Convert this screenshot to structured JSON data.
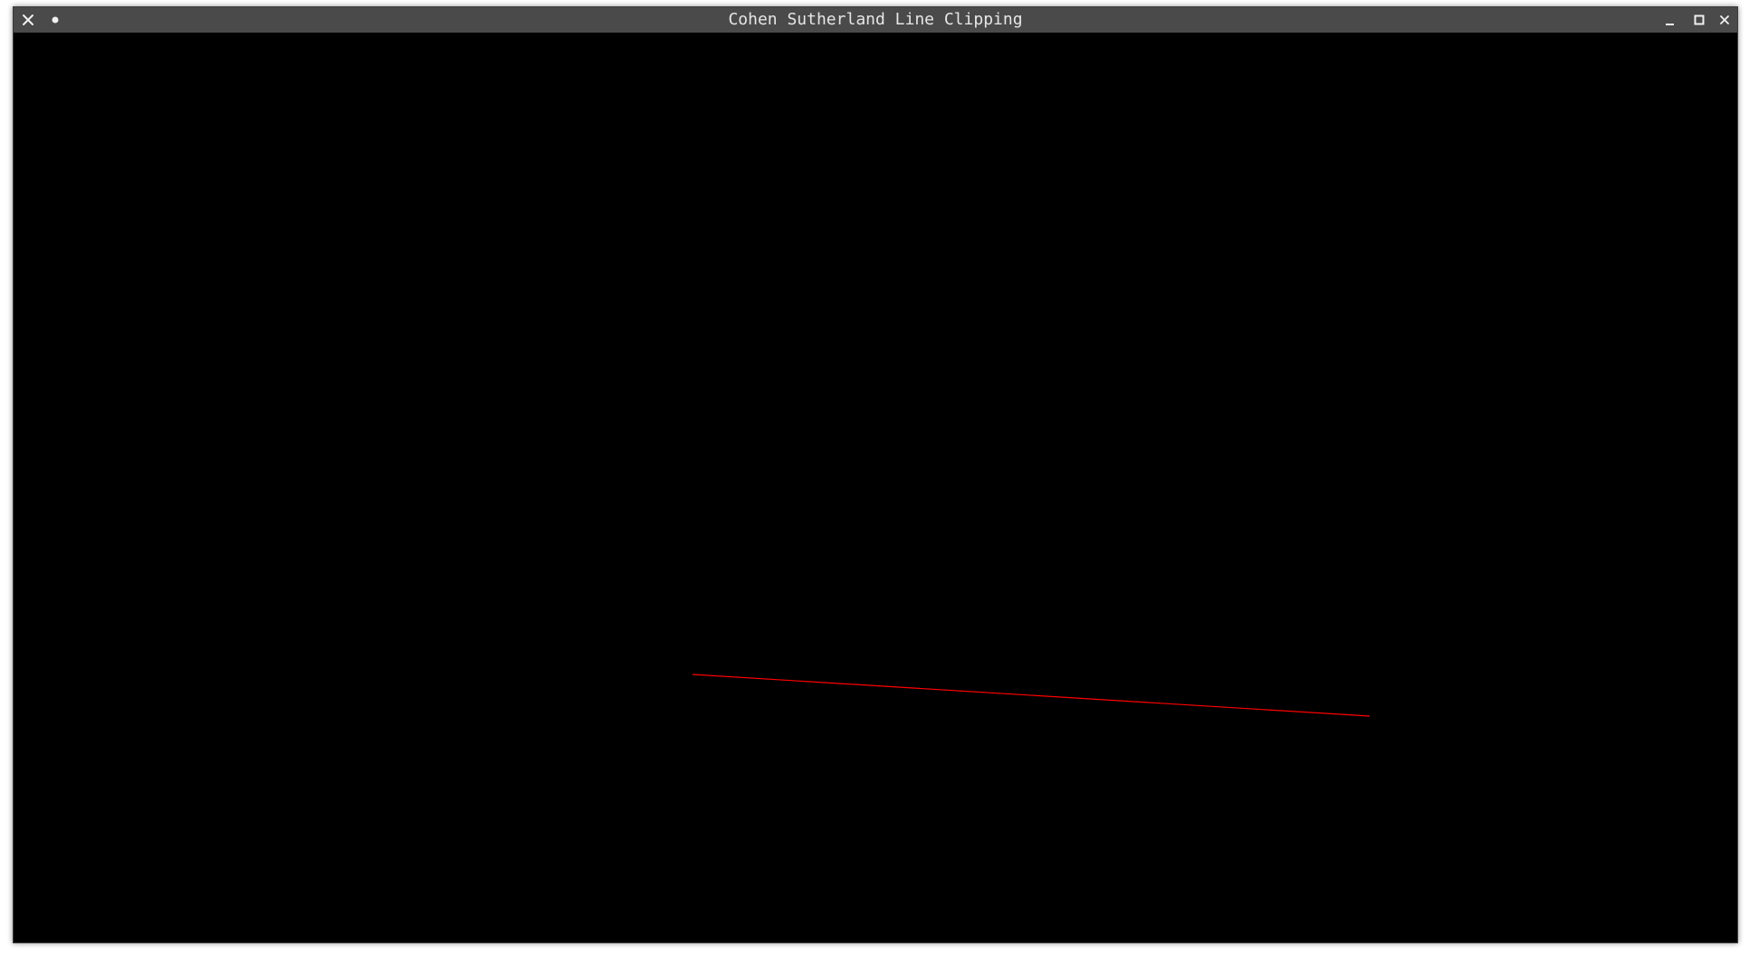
{
  "window": {
    "title": "Cohen Sutherland Line Clipping"
  },
  "titlebar_buttons": {
    "left": [
      "close-icon",
      "pin-dot-icon"
    ],
    "right": [
      "minimize-icon",
      "maximize-icon",
      "close-icon"
    ]
  },
  "colors": {
    "titlebar": "#4a4a4a",
    "canvas_background": "#000000",
    "line": "#ff0000"
  }
}
